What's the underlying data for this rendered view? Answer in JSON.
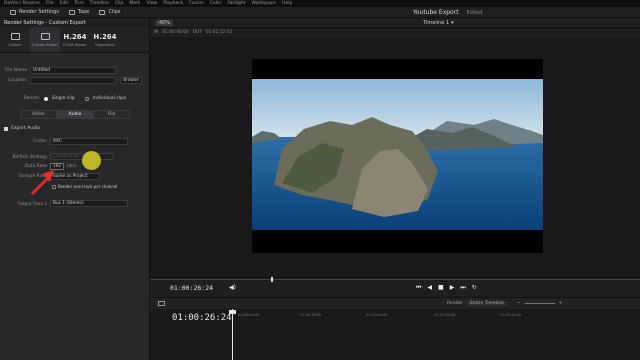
{
  "menubar": {
    "items": [
      "DaVinci Resolve",
      "File",
      "Edit",
      "Trim",
      "Timeline",
      "Clip",
      "Mark",
      "View",
      "Playback",
      "Fusion",
      "Color",
      "Fairlight",
      "Workspace",
      "Help"
    ]
  },
  "toolbar": {
    "render_settings": "Render Settings",
    "tape": "Tape",
    "clips": "Clips",
    "project_title": "Youtube Export",
    "project_status": "Edited"
  },
  "render_panel": {
    "title": "Render Settings - Custom Export",
    "presets": [
      {
        "label": "Custom",
        "big": ""
      },
      {
        "label": "Custom Export",
        "big": ""
      },
      {
        "label": "H.264 Master",
        "big": "H.264"
      },
      {
        "label": "HyperDeck",
        "big": "H.264"
      }
    ],
    "file_name_label": "File Name",
    "file_name_value": "Untitled",
    "location_label": "Location",
    "browse": "Browse",
    "render_label": "Render",
    "single_clip": "Single clip",
    "individual_clips": "Individual clips",
    "tabs": [
      "Video",
      "Audio",
      "File"
    ],
    "export_audio": "Export Audio",
    "codec_label": "Codec",
    "codec_value": "AAC",
    "bitrate_strategy_label": "Bit Rate Strategy",
    "bitrate_strategy_value": "Constant Bit Rate",
    "data_rate_label": "Data Rate",
    "data_rate_value": "192",
    "data_rate_unit": "kb/s",
    "sample_rate_label": "Sample Rate",
    "sample_rate_value": "Same as Project",
    "render_one_track": "Render one track per channel",
    "output_track_label": "Output Track 1",
    "output_track_value": "Bus 1 (Stereo)"
  },
  "viewer": {
    "zoom": "40%",
    "timeline_name": "Timeline 1",
    "in_label": "IN",
    "in_tc": "01:00:00:00",
    "out_label": "OUT",
    "out_tc": "01:02:12:15"
  },
  "transport": {
    "timecode": "01:00:26:24"
  },
  "timeline": {
    "render_label": "Render",
    "render_value": "Entire Timeline",
    "timecode": "01:00:26:24",
    "ruler": [
      "01:00:00:00",
      "01:00:30:00",
      "01:01:00:00",
      "01:01:30:00",
      "01:02:00:00"
    ]
  },
  "colors": {
    "accent": "#d8302a",
    "cursor_highlight": "#f0e628",
    "panel": "#28282b"
  }
}
